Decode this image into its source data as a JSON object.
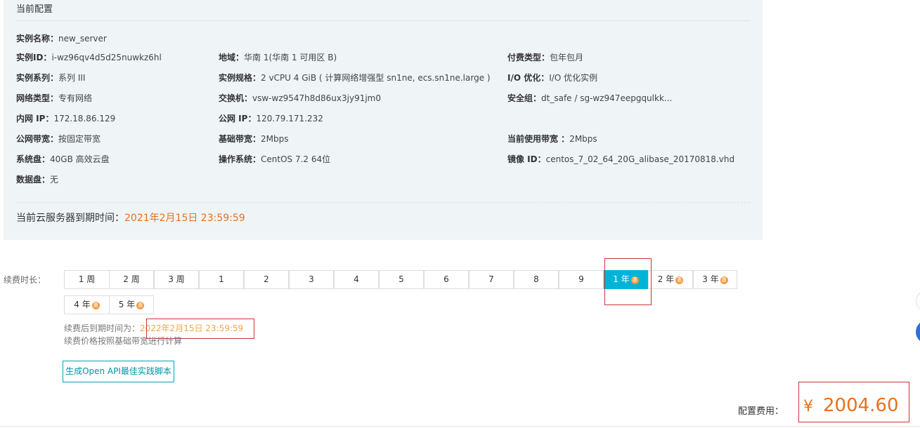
{
  "config": {
    "title": "当前配置",
    "rows": [
      {
        "label": "实例名称：",
        "value": "new_server"
      },
      {
        "label": "实例ID：",
        "value": "i-wz96qv4d5d25nuwkz6hl"
      },
      {
        "label": "地域：",
        "value": "华南 1(华南 1 可用区 B)"
      },
      {
        "label": "付费类型：",
        "value": "包年包月"
      },
      {
        "label": "实例系列：",
        "value": "系列 III"
      },
      {
        "label": "实例规格：",
        "value": "2 vCPU 4 GiB ( 计算网络增强型 sn1ne, ecs.sn1ne.large )"
      },
      {
        "label": "I/O 优化：",
        "value": "I/O 优化实例"
      },
      {
        "label": "网络类型：",
        "value": "专有网络"
      },
      {
        "label": "交换机：",
        "value": "vsw-wz9547h8d86ux3jy91jm0"
      },
      {
        "label": "安全组：",
        "value": "dt_safe / sg-wz947eepgqulkk..."
      },
      {
        "label": "内网 IP：",
        "value": "172.18.86.129"
      },
      {
        "label": "公网 IP：",
        "value": "120.79.171.232"
      },
      {
        "label": "公网带宽：",
        "value": "按固定带宽"
      },
      {
        "label": "基础带宽：",
        "value": "2Mbps"
      },
      {
        "label": "当前使用带宽 ：",
        "value": "2Mbps"
      },
      {
        "label": "系统盘：",
        "value": "40GB 高效云盘"
      },
      {
        "label": "操作系统：",
        "value": "CentOS 7.2 64位"
      },
      {
        "label": "镜像 ID：",
        "value": "centos_7_02_64_20G_alibase_20170818.vhd"
      },
      {
        "label": "数据盘：",
        "value": "无"
      }
    ],
    "expiry_label": "当前云服务器到期时间：",
    "expiry_value": "2021年2月15日 23:59:59"
  },
  "renewal": {
    "label": "续费时长：",
    "badge": "惠",
    "options": [
      "1 周",
      "2 周",
      "3 周",
      "1",
      "2",
      "3",
      "4",
      "5",
      "6",
      "7",
      "8",
      "9",
      "1 年",
      "2 年",
      "3 年",
      "4 年",
      "5 年"
    ],
    "selected_index": 12,
    "after_label": "续费后到期时间为：",
    "after_value": "2022年2月15日 23:59:59",
    "price_note": "续费价格按照基础带宽进行计算",
    "api_button": "生成Open API最佳实践脚本"
  },
  "cost": {
    "label": "配置费用：",
    "currency": "¥",
    "value": "2004.60"
  },
  "colors": {
    "accent": "#00b4d8",
    "price": "#e8711c",
    "badge": "#f39a3e",
    "highlight": "#cc3333"
  }
}
